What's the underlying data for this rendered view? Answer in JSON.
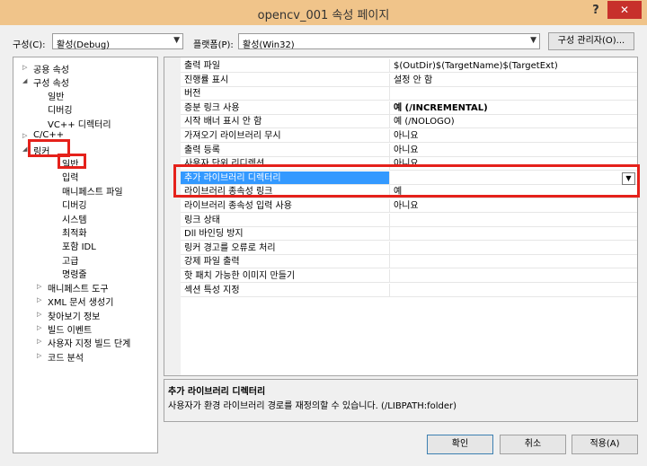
{
  "window": {
    "title": "opencv_001 속성 페이지",
    "help": "?",
    "close": "✕"
  },
  "toolbar": {
    "config_label": "구성(C):",
    "config_value": "활성(Debug)",
    "platform_label": "플랫폼(P):",
    "platform_value": "활성(Win32)",
    "config_manager": "구성 관리자(O)..."
  },
  "tree": [
    {
      "label": "공용 속성",
      "exp": "▷"
    },
    {
      "label": "구성 속성",
      "exp": "◢"
    },
    {
      "label": "일반",
      "exp": ""
    },
    {
      "label": "디버깅",
      "exp": ""
    },
    {
      "label": "VC++ 디렉터리",
      "exp": ""
    },
    {
      "label": "C/C++",
      "exp": "▷"
    },
    {
      "label": "링커",
      "exp": "◢"
    },
    {
      "label": "일반",
      "exp": ""
    },
    {
      "label": "입력",
      "exp": ""
    },
    {
      "label": "매니페스트 파일",
      "exp": ""
    },
    {
      "label": "디버깅",
      "exp": ""
    },
    {
      "label": "시스템",
      "exp": ""
    },
    {
      "label": "최적화",
      "exp": ""
    },
    {
      "label": "포함 IDL",
      "exp": ""
    },
    {
      "label": "고급",
      "exp": ""
    },
    {
      "label": "명령줄",
      "exp": ""
    },
    {
      "label": "매니페스트 도구",
      "exp": "▷"
    },
    {
      "label": "XML 문서 생성기",
      "exp": "▷"
    },
    {
      "label": "찾아보기 정보",
      "exp": "▷"
    },
    {
      "label": "빌드 이벤트",
      "exp": "▷"
    },
    {
      "label": "사용자 지정 빌드 단계",
      "exp": "▷"
    },
    {
      "label": "코드 분석",
      "exp": "▷"
    }
  ],
  "properties": [
    {
      "name": "출력 파일",
      "value": "$(OutDir)$(TargetName)$(TargetExt)"
    },
    {
      "name": "진행률 표시",
      "value": "설정 안 함"
    },
    {
      "name": "버전",
      "value": ""
    },
    {
      "name": "증분 링크 사용",
      "value": "예 (/INCREMENTAL)"
    },
    {
      "name": "시작 배너 표시 안 함",
      "value": "예 (/NOLOGO)"
    },
    {
      "name": "가져오기 라이브러리 무시",
      "value": "아니요"
    },
    {
      "name": "출력 등록",
      "value": "아니요"
    },
    {
      "name": "사용자 단위 리디렉션",
      "value": "아니요"
    },
    {
      "name": "추가 라이브러리 디렉터리",
      "value": ""
    },
    {
      "name": "라이브러리 종속성 링크",
      "value": "예"
    },
    {
      "name": "라이브러리 종속성 입력 사용",
      "value": "아니요"
    },
    {
      "name": "링크 상태",
      "value": ""
    },
    {
      "name": "Dll 바인딩 방지",
      "value": ""
    },
    {
      "name": "링커 경고를 오류로 처리",
      "value": ""
    },
    {
      "name": "강제 파일 출력",
      "value": ""
    },
    {
      "name": "핫 패치 가능한 이미지 만들기",
      "value": ""
    },
    {
      "name": "섹션 특성 지정",
      "value": ""
    }
  ],
  "description": {
    "title": "추가 라이브러리 디렉터리",
    "text": "사용자가 환경 라이브러리 경로를 재정의할 수 있습니다. (/LIBPATH:folder)"
  },
  "buttons": {
    "ok": "확인",
    "cancel": "취소",
    "apply": "적용(A)"
  },
  "colors": {
    "titlebar": "#f0c48a",
    "selection": "#3399ff",
    "highlight": "#e5211b",
    "close": "#c7312b"
  }
}
